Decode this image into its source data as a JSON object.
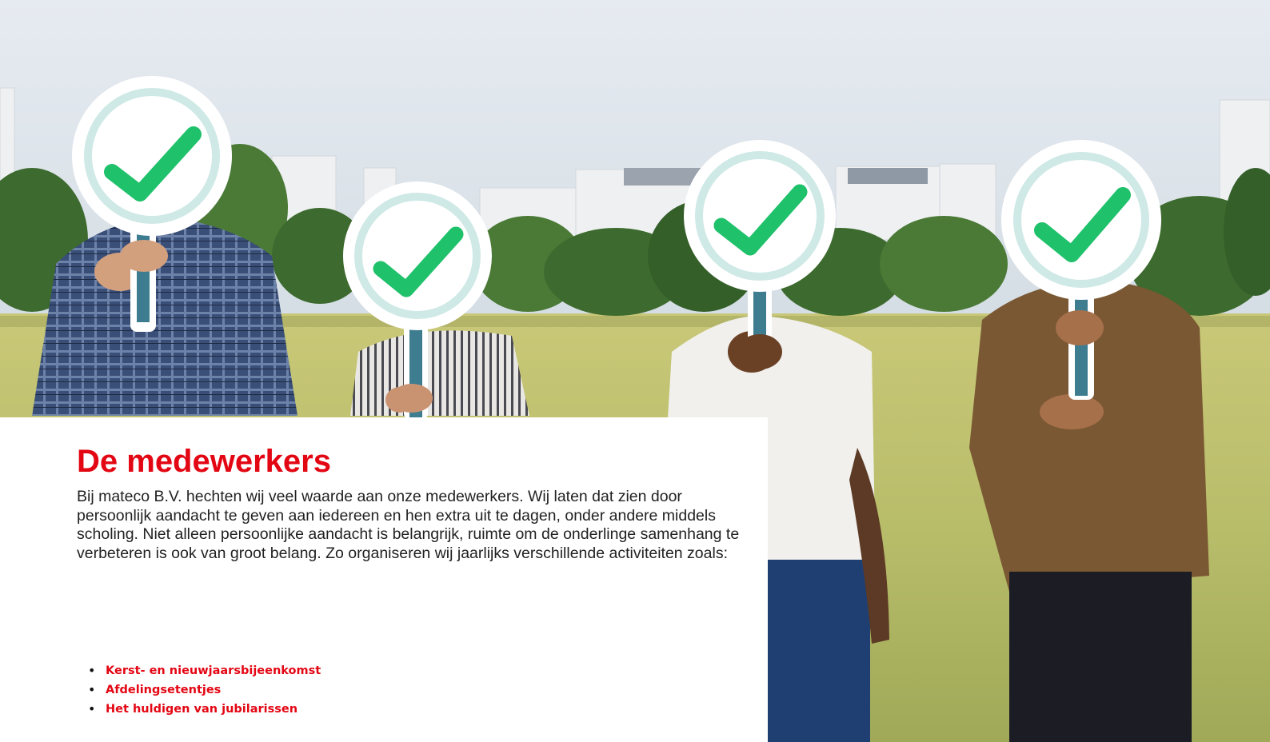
{
  "section": {
    "title": "De medewerkers",
    "body": "Bij mateco B.V. hechten wij veel waarde aan onze medewerkers. Wij laten dat zien door persoonlijk aandacht te geven aan iedereen en hen extra uit te dagen, onder andere middels scholing. Niet alleen persoonlijke aandacht is belangrijk, ruimte om de onderlinge samenhang te verbeteren is ook van groot belang. Zo organiseren wij jaarlijks verschillende activiteiten zoals:",
    "activities": [
      "Kerst- en nieuwjaarsbijeenkomst",
      "Afdelingsetentjes",
      "Het huldigen van jubilarissen"
    ]
  },
  "colors": {
    "accent": "#e30613",
    "check": "#1fc16b",
    "sign_ring": "#cfe9e6",
    "text": "#222222"
  }
}
